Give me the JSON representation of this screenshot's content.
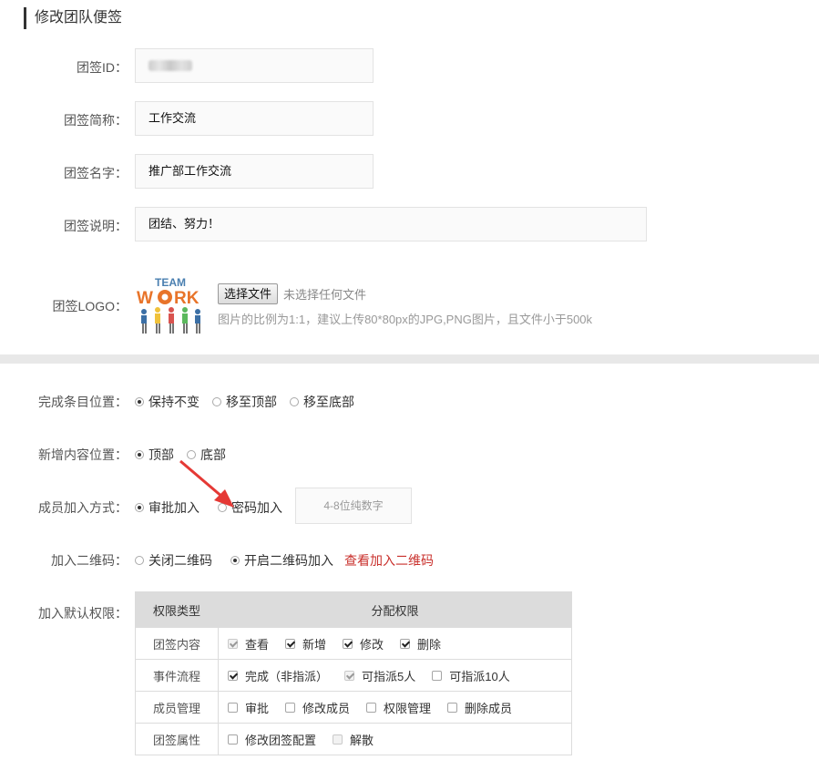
{
  "section_title": "修改团队便签",
  "fields": {
    "id_label": "团签ID：",
    "short_label": "团签简称：",
    "short_value": "工作交流",
    "name_label": "团签名字：",
    "name_value": "推广部工作交流",
    "desc_label": "团签说明：",
    "desc_value": "团结、努力！",
    "logo_label": "团签LOGO：",
    "logo_text_top": "TEAM",
    "logo_text_main": "W RK",
    "logo_letter_o": "O",
    "choose_file": "选择文件",
    "no_file": "未选择任何文件",
    "file_hint": "图片的比例为1:1，建议上传80*80px的JPG,PNG图片，且文件小于500k"
  },
  "settings": {
    "complete_label": "完成条目位置：",
    "complete_options": [
      "保持不变",
      "移至顶部",
      "移至底部"
    ],
    "complete_selected": "保持不变",
    "new_label": "新增内容位置：",
    "new_options": [
      "顶部",
      "底部"
    ],
    "new_selected": "顶部",
    "join_label": "成员加入方式：",
    "join_options": [
      "审批加入",
      "密码加入"
    ],
    "join_selected": "审批加入",
    "password_placeholder": "4-8位纯数字",
    "qr_label": "加入二维码：",
    "qr_options": [
      "关闭二维码",
      "开启二维码加入"
    ],
    "qr_selected": "开启二维码加入",
    "qr_link": "查看加入二维码",
    "perm_label": "加入默认权限："
  },
  "permissions": {
    "header_type": "权限类型",
    "header_assign": "分配权限",
    "rows": [
      {
        "type": "团签内容",
        "options": [
          {
            "label": "查看",
            "checked": true,
            "disabled": true
          },
          {
            "label": "新增",
            "checked": true,
            "disabled": false
          },
          {
            "label": "修改",
            "checked": true,
            "disabled": false
          },
          {
            "label": "删除",
            "checked": true,
            "disabled": false
          }
        ]
      },
      {
        "type": "事件流程",
        "options": [
          {
            "label": "完成（非指派）",
            "checked": true,
            "disabled": false
          },
          {
            "label": "可指派5人",
            "checked": true,
            "disabled": true
          },
          {
            "label": "可指派10人",
            "checked": false,
            "disabled": false
          }
        ]
      },
      {
        "type": "成员管理",
        "options": [
          {
            "label": "审批",
            "checked": false,
            "disabled": false
          },
          {
            "label": "修改成员",
            "checked": false,
            "disabled": false
          },
          {
            "label": "权限管理",
            "checked": false,
            "disabled": false
          },
          {
            "label": "删除成员",
            "checked": false,
            "disabled": false
          }
        ]
      },
      {
        "type": "团签属性",
        "options": [
          {
            "label": "修改团签配置",
            "checked": false,
            "disabled": false
          },
          {
            "label": "解散",
            "checked": false,
            "disabled": true
          }
        ]
      }
    ]
  },
  "colors": {
    "link": "#c9302c",
    "arrow": "#e53935",
    "table_header": "#dcdcdc"
  }
}
